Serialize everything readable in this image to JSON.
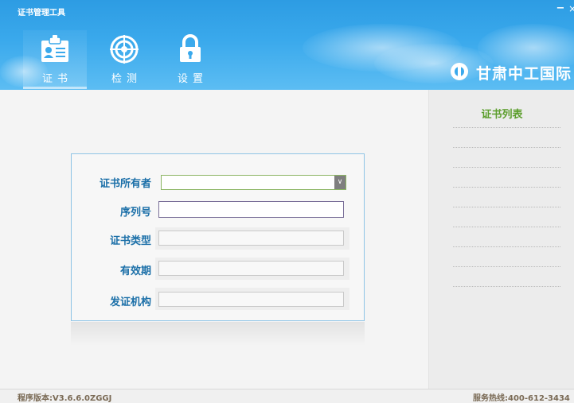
{
  "window": {
    "title": "证书管理工具",
    "minimize": "−",
    "close": "×"
  },
  "nav": {
    "items": [
      {
        "label": "证书",
        "icon": "certificate-icon"
      },
      {
        "label": "检测",
        "icon": "target-icon"
      },
      {
        "label": "设置",
        "icon": "lock-icon"
      }
    ],
    "active_index": 0
  },
  "brand": {
    "logo_text": "甘肃中工国际"
  },
  "form": {
    "owner_label": "证书所有者",
    "owner_value": "",
    "serial_label": "序列号",
    "serial_value": "",
    "type_label": "证书类型",
    "type_value": "",
    "validity_label": "有效期",
    "validity_value": "",
    "issuer_label": "发证机构",
    "issuer_value": ""
  },
  "cert_list": {
    "title": "证书列表",
    "items": []
  },
  "footer": {
    "version": "程序版本:V3.6.6.0ZGGJ",
    "hotline": "服务热线:400-612-3434"
  },
  "colors": {
    "header_blue": "#3aa9ec",
    "label_blue": "#1b6fa8",
    "list_title_green": "#5a9d2a"
  }
}
